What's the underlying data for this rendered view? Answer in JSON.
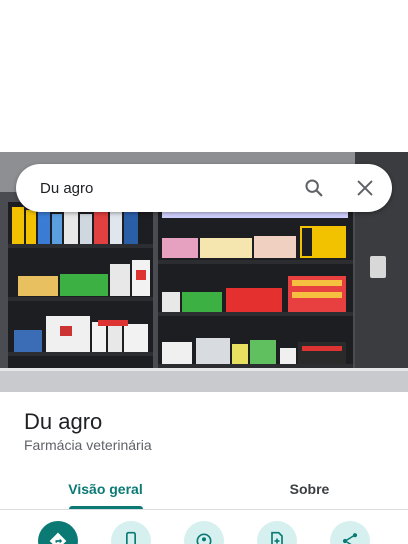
{
  "search": {
    "value": "Du agro",
    "icons": [
      "search-icon",
      "close-icon"
    ]
  },
  "place": {
    "name": "Du agro",
    "category": "Farmácia veterinária"
  },
  "tabs": [
    {
      "label": "Visão geral",
      "selected": true
    },
    {
      "label": "Sobre",
      "selected": false
    }
  ],
  "actions": [
    {
      "icon": "directions-icon",
      "style": "primary"
    },
    {
      "icon": "phone-icon",
      "style": "secondary"
    },
    {
      "icon": "nearby-icon",
      "style": "secondary"
    },
    {
      "icon": "save-icon",
      "style": "secondary"
    },
    {
      "icon": "share-icon",
      "style": "secondary"
    }
  ],
  "colors": {
    "accent": "#0b7a75",
    "action_light": "#d6f0ef",
    "text_primary": "#202124",
    "text_secondary": "#5f6368"
  }
}
